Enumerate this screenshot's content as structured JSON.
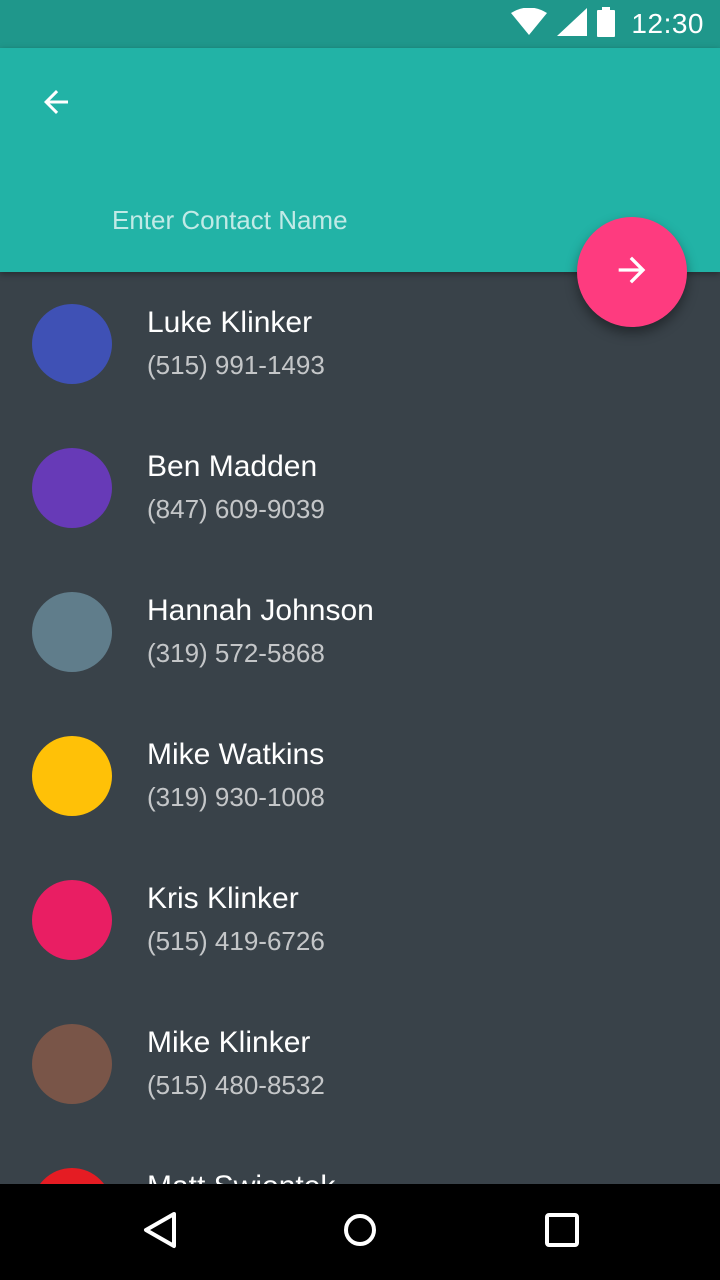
{
  "status_bar": {
    "time": "12:30",
    "icons": [
      "wifi-icon",
      "cell-signal-icon",
      "battery-icon"
    ],
    "color": "#1f978b"
  },
  "app_bar": {
    "color": "#22b3a6",
    "back_icon": "arrow-left-icon",
    "contact_input": {
      "placeholder": "Enter Contact Name",
      "value": ""
    }
  },
  "fab": {
    "icon": "arrow-right-icon",
    "color": "#fe3b7f"
  },
  "contacts": [
    {
      "name": "Luke Klinker",
      "phone": "(515) 991-1493",
      "color": "#3f51b5"
    },
    {
      "name": "Ben Madden",
      "phone": "(847) 609-9039",
      "color": "#673ab7"
    },
    {
      "name": "Hannah Johnson",
      "phone": "(319) 572-5868",
      "color": "#607d8b"
    },
    {
      "name": "Mike Watkins",
      "phone": "(319) 930-1008",
      "color": "#ffc107"
    },
    {
      "name": "Kris Klinker",
      "phone": "(515) 419-6726",
      "color": "#e91e63"
    },
    {
      "name": "Mike Klinker",
      "phone": "(515) 480-8532",
      "color": "#795548"
    },
    {
      "name": "Matt Swiontek",
      "phone": "",
      "color": "#e51c23"
    }
  ],
  "nav_bar": {
    "buttons": [
      "back-triangle-icon",
      "home-circle-icon",
      "recents-square-icon"
    ]
  }
}
